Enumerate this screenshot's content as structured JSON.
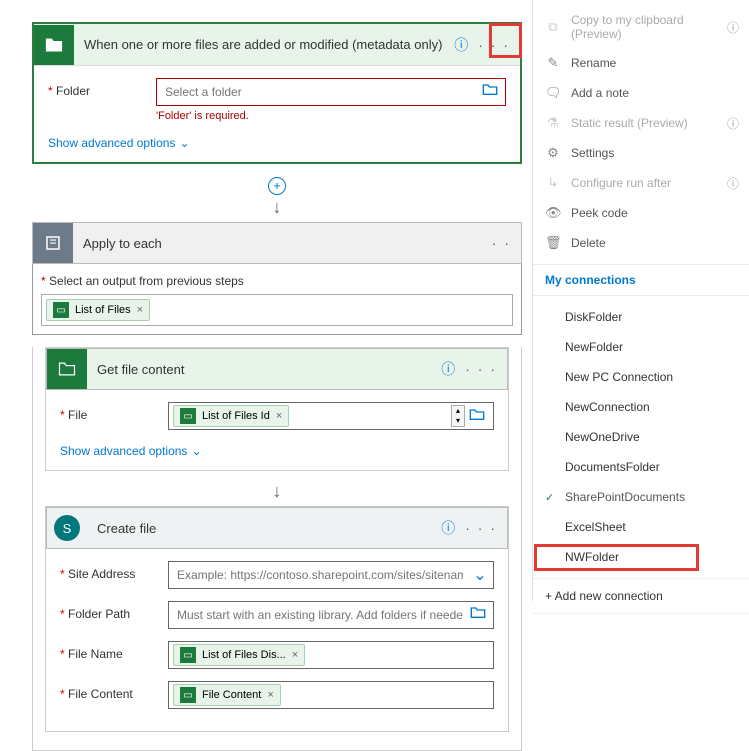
{
  "trigger": {
    "title": "When one or more files are added or modified (metadata only)",
    "folder_label": "Folder",
    "folder_placeholder": "Select a folder",
    "folder_error": "'Folder' is required.",
    "advanced": "Show advanced options"
  },
  "apply": {
    "title": "Apply to each",
    "output_label": "Select an output from previous steps",
    "chip_list": "List of Files"
  },
  "getfile": {
    "title": "Get file content",
    "file_label": "File",
    "chip": "List of Files Id",
    "advanced": "Show advanced options"
  },
  "createfile": {
    "title": "Create file",
    "site_label": "Site Address",
    "site_ph": "Example: https://contoso.sharepoint.com/sites/sitename.",
    "folder_label": "Folder Path",
    "folder_ph": "Must start with an existing library. Add folders if needed.",
    "name_label": "File Name",
    "name_chip": "List of Files Dis...",
    "content_label": "File Content",
    "content_chip": "File Content"
  },
  "menu": {
    "copy": "Copy to my clipboard (Preview)",
    "rename": "Rename",
    "note": "Add a note",
    "static": "Static result (Preview)",
    "settings": "Settings",
    "runafter": "Configure run after",
    "peek": "Peek code",
    "delete": "Delete",
    "connections_hdr": "My connections",
    "connections": [
      "DiskFolder",
      "NewFolder",
      "New PC Connection",
      "NewConnection",
      "NewOneDrive",
      "DocumentsFolder",
      "SharePointDocuments",
      "ExcelSheet",
      "NWFolder"
    ],
    "selected": "SharePointDocuments",
    "addnew": "+ Add new connection"
  }
}
